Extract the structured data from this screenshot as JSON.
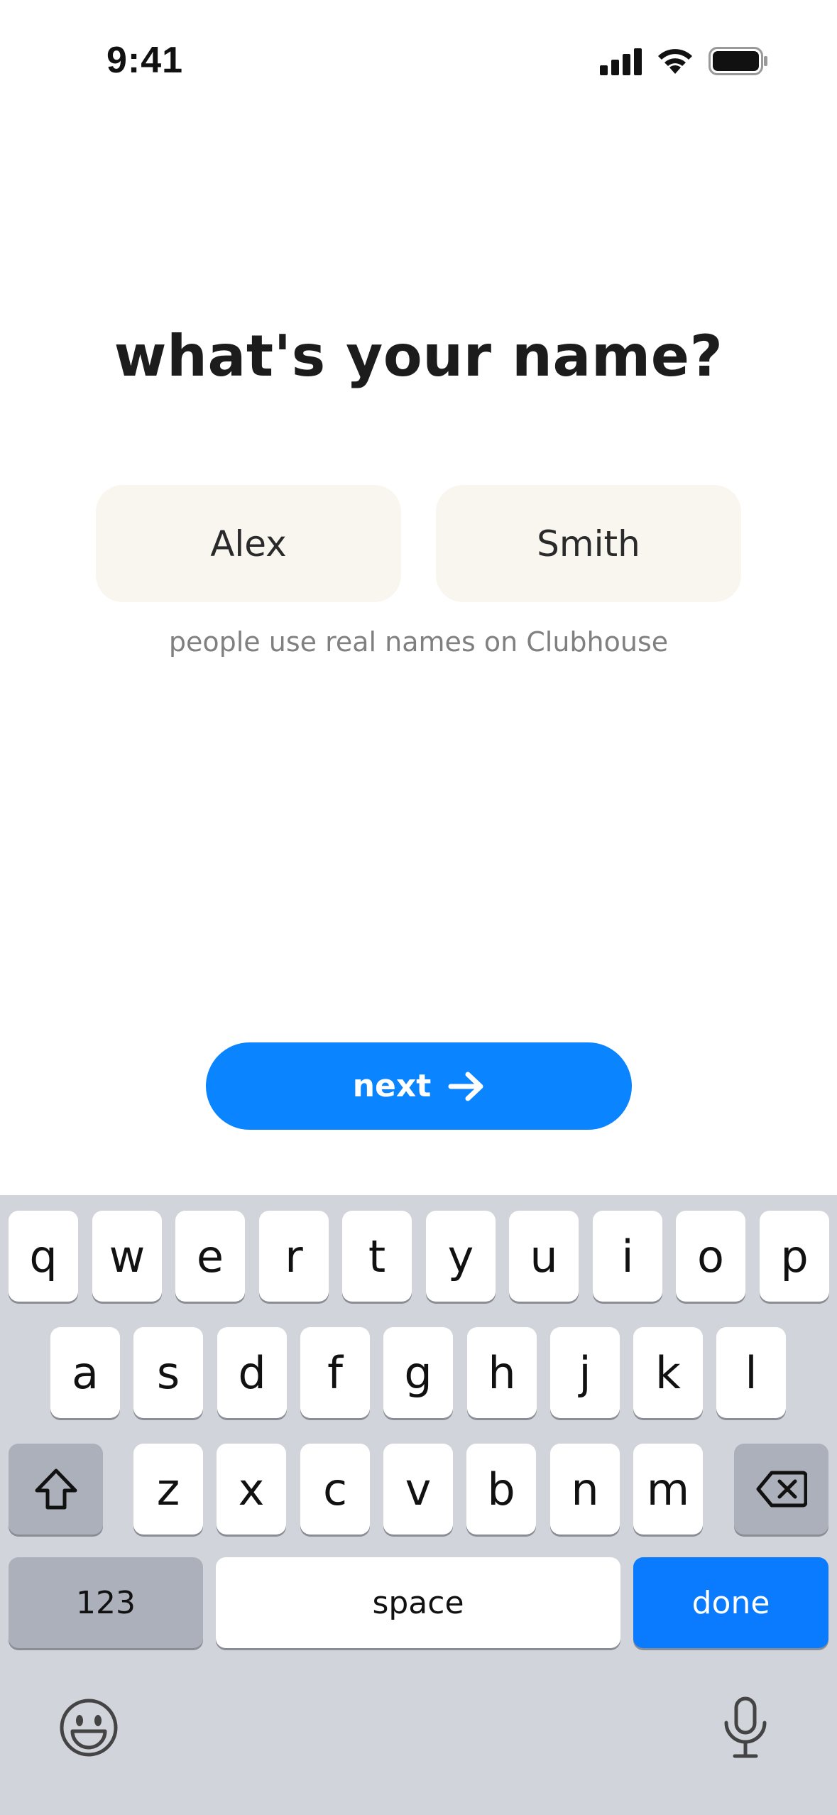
{
  "status_bar": {
    "time": "9:41"
  },
  "title": "what's your name?",
  "form": {
    "first_name": "Alex",
    "last_name": "Smith",
    "hint": "people use real names on Clubhouse"
  },
  "next_button": {
    "label": "next",
    "icon": "arrow-right-icon",
    "color": "#0a84ff"
  },
  "keyboard": {
    "row1": [
      "q",
      "w",
      "e",
      "r",
      "t",
      "y",
      "u",
      "i",
      "o",
      "p"
    ],
    "row2": [
      "a",
      "s",
      "d",
      "f",
      "g",
      "h",
      "j",
      "k",
      "l"
    ],
    "row3": [
      "z",
      "x",
      "c",
      "v",
      "b",
      "n",
      "m"
    ],
    "numbers_label": "123",
    "space_label": "space",
    "done_label": "done",
    "shift_icon": "shift-icon",
    "delete_icon": "delete-icon",
    "emoji_icon": "emoji-icon",
    "mic_icon": "microphone-icon",
    "accent_color": "#0a7aff"
  }
}
